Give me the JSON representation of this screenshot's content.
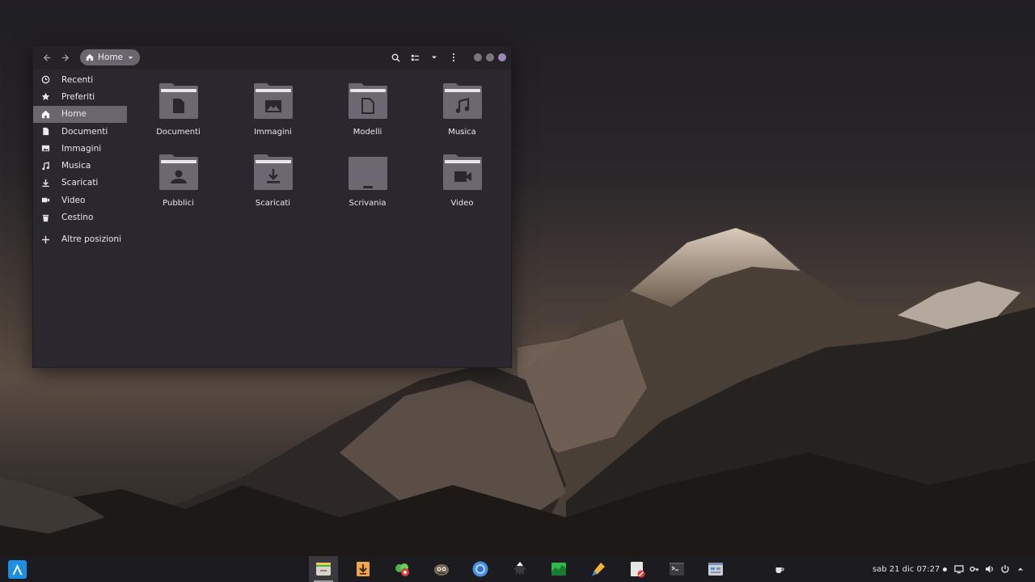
{
  "window": {
    "location": "Home"
  },
  "sidebar": {
    "items": [
      {
        "label": "Recenti",
        "icon": "clock-icon"
      },
      {
        "label": "Preferiti",
        "icon": "star-icon"
      },
      {
        "label": "Home",
        "icon": "home-icon",
        "active": true
      },
      {
        "label": "Documenti",
        "icon": "document-icon"
      },
      {
        "label": "Immagini",
        "icon": "image-icon"
      },
      {
        "label": "Musica",
        "icon": "music-icon"
      },
      {
        "label": "Scaricati",
        "icon": "download-icon"
      },
      {
        "label": "Video",
        "icon": "video-icon"
      },
      {
        "label": "Cestino",
        "icon": "trash-icon"
      }
    ],
    "other_locations": "Altre posizioni"
  },
  "folders": [
    {
      "label": "Documenti",
      "icon": "document-folder-icon"
    },
    {
      "label": "Immagini",
      "icon": "image-folder-icon"
    },
    {
      "label": "Modelli",
      "icon": "template-folder-icon"
    },
    {
      "label": "Musica",
      "icon": "music-folder-icon"
    },
    {
      "label": "Pubblici",
      "icon": "public-folder-icon"
    },
    {
      "label": "Scaricati",
      "icon": "download-folder-icon"
    },
    {
      "label": "Scrivania",
      "icon": "desktop-folder-icon"
    },
    {
      "label": "Video",
      "icon": "video-folder-icon"
    }
  ],
  "taskbar": {
    "clock": "sab 21 dic  07:27",
    "apps": [
      "files-icon",
      "downloader-icon",
      "tweaks-icon",
      "gimp-icon",
      "chromium-icon",
      "inkscape-icon",
      "system-monitor-icon",
      "color-picker-icon",
      "text-editor-icon",
      "terminal-icon",
      "settings-icon"
    ]
  },
  "colors": {
    "accent": "#9b8ab8",
    "selection": "#6a6670",
    "window_bg": "#2a282e",
    "headerbar_bg": "#242227",
    "taskbar_bg": "#1c1b20",
    "start_button": "#1e8fe0"
  }
}
